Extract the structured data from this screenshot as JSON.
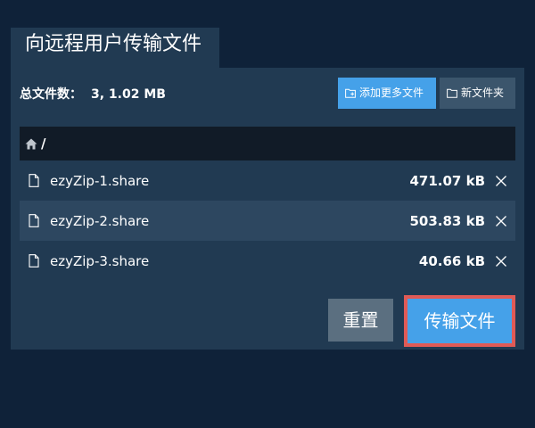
{
  "dialog": {
    "title": "向远程用户传输文件"
  },
  "summary": {
    "label": "总文件数：",
    "value": "3, 1.02 MB"
  },
  "toolbar": {
    "add_more_label": "添加更多文件",
    "new_folder_label": "新文件夹",
    "add_more_icon": "folder-plus-icon",
    "new_folder_icon": "folder-icon"
  },
  "path": {
    "home_icon": "home-icon",
    "text": "/"
  },
  "files": [
    {
      "name": "ezyZip-1.share",
      "size": "471.07 kB"
    },
    {
      "name": "ezyZip-2.share",
      "size": "503.83 kB"
    },
    {
      "name": "ezyZip-3.share",
      "size": "40.66 kB"
    }
  ],
  "actions": {
    "reset_label": "重置",
    "transfer_label": "传输文件"
  },
  "colors": {
    "background": "#0f2239",
    "panel": "#213a52",
    "accent": "#45a1e9",
    "highlight_border": "#e05a56"
  }
}
